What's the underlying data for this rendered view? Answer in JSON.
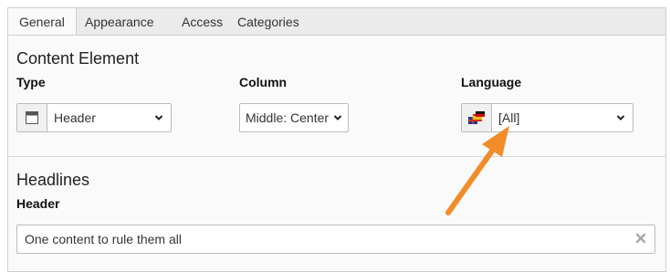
{
  "tabs": [
    {
      "label": "General",
      "active": true
    },
    {
      "label": "Appearance",
      "active": false
    },
    {
      "label": "Access",
      "active": false
    },
    {
      "label": "Categories",
      "active": false
    }
  ],
  "content_element": {
    "title": "Content Element",
    "type": {
      "label": "Type",
      "value": "Header",
      "icon": "content-header-icon"
    },
    "column": {
      "label": "Column",
      "value": "Middle: Center"
    },
    "language": {
      "label": "Language",
      "value": "[All]",
      "icon": "flags-multiple-icon"
    }
  },
  "headlines": {
    "title": "Headlines",
    "header": {
      "label": "Header",
      "value": "One content to rule them all"
    }
  },
  "colors": {
    "annotation_arrow": "#f28c28",
    "tab_bar": "#ebebeb",
    "panel": "#fafafa"
  }
}
